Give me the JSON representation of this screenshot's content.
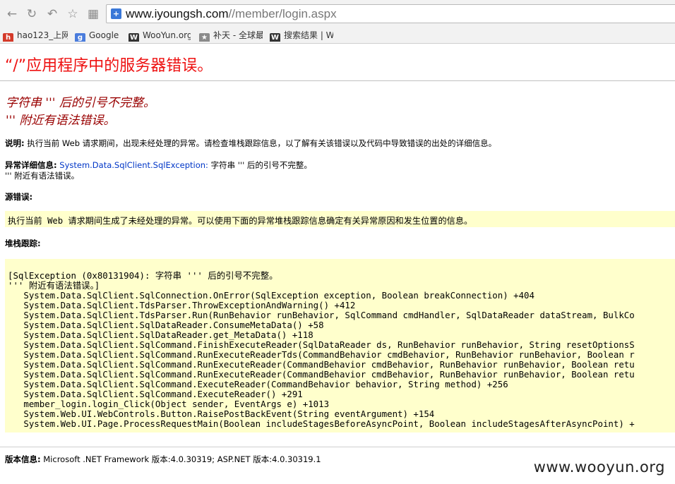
{
  "browser": {
    "url_host": "www.iyoungsh.com",
    "url_path": "//member/login.aspx",
    "nav_icons": [
      "back-icon",
      "forward-icon",
      "reload-icon",
      "star-icon",
      "apps-icon"
    ],
    "bookmarks": [
      {
        "label": "hao123_上网",
        "icon": "hao123-icon",
        "color": "#d43a2a"
      },
      {
        "label": "Google",
        "icon": "google-icon",
        "color": "#4a7cdc"
      },
      {
        "label": "WooYun.org",
        "icon": "wooyun-icon",
        "color": "#333333"
      },
      {
        "label": "补天 - 全球最",
        "icon": "butian-icon",
        "color": "#7a7a7a"
      },
      {
        "label": "搜索结果 | W",
        "icon": "wooyun-icon",
        "color": "#333333"
      }
    ]
  },
  "error": {
    "title": "“/”应用程序中的服务器错误。",
    "message_line1": "字符串 ''' 后的引号不完整。",
    "message_line2": "''' 附近有语法错误。",
    "description_label": "说明:",
    "description_text": " 执行当前 Web 请求期间，出现未经处理的异常。请检查堆栈跟踪信息，以了解有关该错误以及代码中导致错误的出处的详细信息。",
    "exception_label": "异常详细信息:",
    "exception_type": " System.Data.SqlClient.SqlException:",
    "exception_text": " 字符串 ''' 后的引号不完整。",
    "exception_text2": "''' 附近有语法错误。",
    "source_label": "源错误:",
    "source_text": "执行当前 Web 请求期间生成了未经处理的异常。可以使用下面的异常堆栈跟踪信息确定有关异常原因和发生位置的信息。",
    "stack_label": "堆栈跟踪:",
    "stack_lines": [
      "[SqlException (0x80131904): 字符串 ''' 后的引号不完整。",
      "''' 附近有语法错误。]",
      "   System.Data.SqlClient.SqlConnection.OnError(SqlException exception, Boolean breakConnection) +404",
      "   System.Data.SqlClient.TdsParser.ThrowExceptionAndWarning() +412",
      "   System.Data.SqlClient.TdsParser.Run(RunBehavior runBehavior, SqlCommand cmdHandler, SqlDataReader dataStream, BulkCo",
      "   System.Data.SqlClient.SqlDataReader.ConsumeMetaData() +58",
      "   System.Data.SqlClient.SqlDataReader.get_MetaData() +118",
      "   System.Data.SqlClient.SqlCommand.FinishExecuteReader(SqlDataReader ds, RunBehavior runBehavior, String resetOptionsS",
      "   System.Data.SqlClient.SqlCommand.RunExecuteReaderTds(CommandBehavior cmdBehavior, RunBehavior runBehavior, Boolean r",
      "   System.Data.SqlClient.SqlCommand.RunExecuteReader(CommandBehavior cmdBehavior, RunBehavior runBehavior, Boolean retu",
      "   System.Data.SqlClient.SqlCommand.RunExecuteReader(CommandBehavior cmdBehavior, RunBehavior runBehavior, Boolean retu",
      "   System.Data.SqlClient.SqlCommand.ExecuteReader(CommandBehavior behavior, String method) +256",
      "   System.Data.SqlClient.SqlCommand.ExecuteReader() +291",
      "   member_login.login_Click(Object sender, EventArgs e) +1013",
      "   System.Web.UI.WebControls.Button.RaisePostBackEvent(String eventArgument) +154",
      "   System.Web.UI.Page.ProcessRequestMain(Boolean includeStagesBeforeAsyncPoint, Boolean includeStagesAfterAsyncPoint) +"
    ],
    "version_label": "版本信息:",
    "version_text": " Microsoft .NET Framework 版本:4.0.30319; ASP.NET 版本:4.0.30319.1"
  },
  "watermark": "www.wooyun.org",
  "colors": {
    "title": "#ee1111",
    "message": "#990000",
    "highlight_box": "#ffffcc",
    "type_link": "#0036c7"
  }
}
